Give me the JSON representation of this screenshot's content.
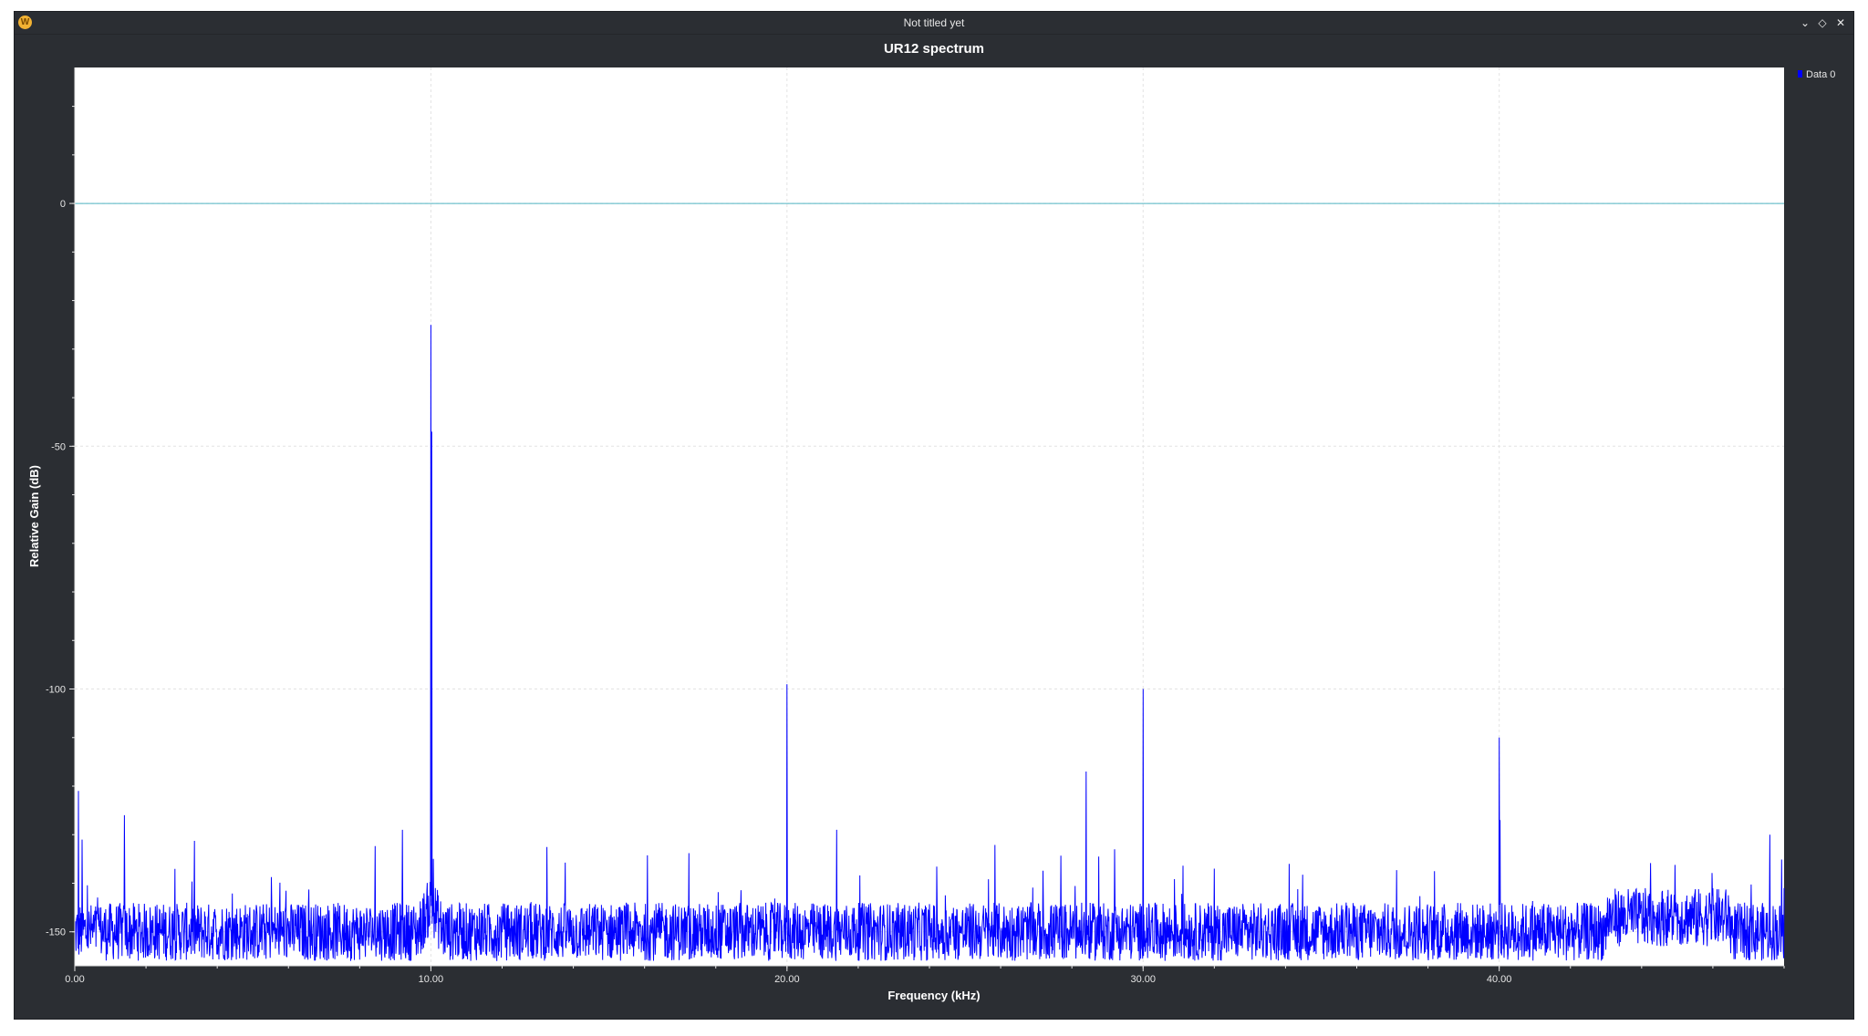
{
  "window": {
    "title": "Not titled yet",
    "icon": "app-logo-icon",
    "controls": [
      "chevron-down-icon",
      "maximize-icon",
      "close-icon"
    ]
  },
  "chart_data": {
    "type": "line",
    "title": "UR12 spectrum",
    "xlabel": "Frequency (kHz)",
    "ylabel": "Relative Gain (dB)",
    "xlim": [
      0,
      48
    ],
    "ylim": [
      -157,
      28
    ],
    "x_ticks": [
      0,
      10,
      20,
      30,
      40
    ],
    "x_tick_labels": [
      "0.00",
      "10.00",
      "20.00",
      "30.00",
      "40.00"
    ],
    "y_ticks": [
      0,
      -50,
      -100,
      -150
    ],
    "y_tick_labels": [
      "0",
      "-50",
      "-100",
      "-150"
    ],
    "grid": true,
    "legend_position": "top-right",
    "reference_line": {
      "y": 0,
      "color": "#4fb3c2"
    },
    "noise_floor": {
      "level": -150,
      "spread": 6
    },
    "series": [
      {
        "name": "Data 0",
        "color": "#0000ff",
        "peaks": [
          {
            "x": 0.1,
            "y": -121
          },
          {
            "x": 0.2,
            "y": -131
          },
          {
            "x": 1.4,
            "y": -126
          },
          {
            "x": 9.2,
            "y": -129
          },
          {
            "x": 10.0,
            "y": -25
          },
          {
            "x": 10.02,
            "y": -47
          },
          {
            "x": 20.0,
            "y": -99
          },
          {
            "x": 21.4,
            "y": -129
          },
          {
            "x": 28.4,
            "y": -117
          },
          {
            "x": 29.2,
            "y": -133
          },
          {
            "x": 30.0,
            "y": -100
          },
          {
            "x": 32.0,
            "y": -137
          },
          {
            "x": 34.1,
            "y": -136
          },
          {
            "x": 40.0,
            "y": -110
          },
          {
            "x": 40.02,
            "y": -127
          },
          {
            "x": 47.6,
            "y": -130
          },
          {
            "x": 48.0,
            "y": -141
          }
        ]
      }
    ]
  }
}
